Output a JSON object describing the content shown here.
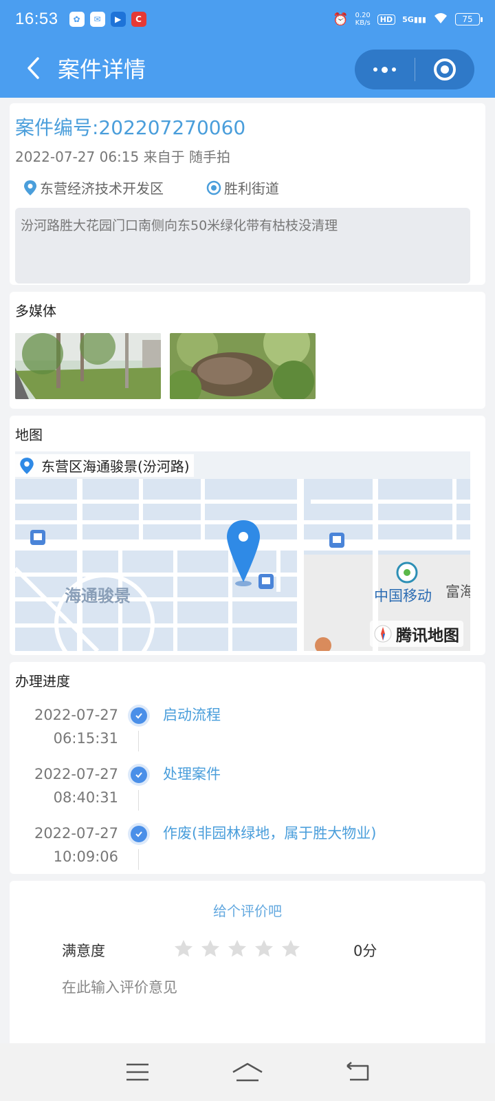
{
  "status_bar": {
    "time": "16:53",
    "speed_value": "0.20",
    "speed_unit": "KB/s",
    "hd": "HD",
    "network": "5G",
    "battery": "75"
  },
  "header": {
    "title": "案件详情"
  },
  "case": {
    "number_label": "案件编号:202207270060",
    "meta": "2022-07-27 06:15 来自于 随手拍",
    "district": "东营经济技术开发区",
    "street": "胜利街道",
    "description": "汾河路胜大花园门口南侧向东50米绿化带有枯枝没清理"
  },
  "media": {
    "title": "多媒体"
  },
  "map": {
    "title": "地图",
    "address": "东营区海通骏景(汾河路)",
    "labels": {
      "community": "海通骏景",
      "china_mobile": "中国移动",
      "fuhai": "富海",
      "brand": "腾讯地图"
    }
  },
  "progress": {
    "title": "办理进度",
    "steps": [
      {
        "date": "2022-07-27",
        "time": "06:15:31",
        "name": "启动流程"
      },
      {
        "date": "2022-07-27",
        "time": "08:40:31",
        "name": "处理案件"
      },
      {
        "date": "2022-07-27",
        "time": "10:09:06",
        "name": "作废(非园林绿地，属于胜大物业)"
      }
    ]
  },
  "rating": {
    "title": "给个评价吧",
    "label": "满意度",
    "score": "0分",
    "stars_filled": 0,
    "stars_total": 5,
    "comment_placeholder": "在此输入评价意见"
  },
  "colors": {
    "header_bg": "#4b9ef0",
    "accent": "#4a9edb",
    "step_dot": "#4a8fe8",
    "star_empty": "#dddddd"
  }
}
